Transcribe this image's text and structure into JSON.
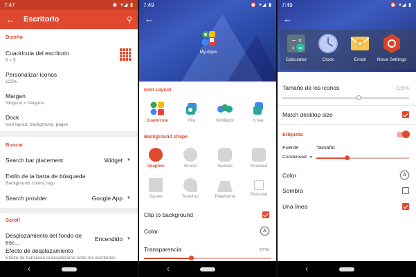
{
  "screen1": {
    "status_time": "7:47",
    "toolbar": {
      "title": "Escritorio"
    },
    "sections": {
      "design": "Diseño",
      "search": "Buscar",
      "scroll": "Scroll"
    },
    "items": {
      "grid": {
        "title": "Cuadrícula del escritorio",
        "sub": "6 × 5"
      },
      "icons": {
        "title": "Personalizar iconos",
        "sub": "125%"
      },
      "margin": {
        "title": "Margen",
        "sub": "Ninguno × Ninguno"
      },
      "dock": {
        "title": "Dock",
        "sub": "Icon layout, background, pages"
      },
      "searchbar_placement": {
        "title": "Search bar placement",
        "value": "Widget"
      },
      "searchbar_style": {
        "title": "Estilo de la barra de búsqueda",
        "sub": "Background, colors, logo"
      },
      "search_provider": {
        "title": "Search provider",
        "value": "Google App"
      },
      "wallpaper_scroll": {
        "title": "Desplazamiento del fondo de esc…",
        "value": "Encendido"
      },
      "scroll_effect": {
        "title": "Efecto de desplazamiento",
        "sub": "Efecto de transición al desplazarse entre los escritorios"
      }
    }
  },
  "screen2": {
    "status_time": "7:49",
    "my_apps_label": "My Apps",
    "icon_layout_header": "Icon Layout",
    "layouts": [
      "Cuadrícula",
      "Pila",
      "Ventilador",
      "Línea"
    ],
    "background_shape_header": "Background shape",
    "shapes": [
      "Adaptive",
      "Round",
      "Squircle",
      "Rounded",
      "Square",
      "Teardrop",
      "Plataforma",
      "Personal"
    ],
    "clip_label": "Clip to background",
    "color_label": "Color",
    "transparency_label": "Transparencia",
    "transparency_value": "37%",
    "transparency": 0.37
  },
  "screen3": {
    "status_time": "7:49",
    "apps": [
      "Calculator",
      "Clock",
      "Email",
      "Nova Settings"
    ],
    "icon_size_label": "Tamaño de los iconos",
    "icon_size_value": "125%",
    "match_label": "Match desktop size",
    "label_header": "Etiqueta",
    "font_label": "Fuente",
    "font_value": "Condensed",
    "size_label": "Tamaño",
    "color_label": "Color",
    "shadow_label": "Sombra",
    "oneline_label": "Una línea",
    "icon_size": 0.6,
    "label_size": 0.33
  },
  "colors": {
    "accent": "#e0492f",
    "hero": "#3d5cc0"
  }
}
